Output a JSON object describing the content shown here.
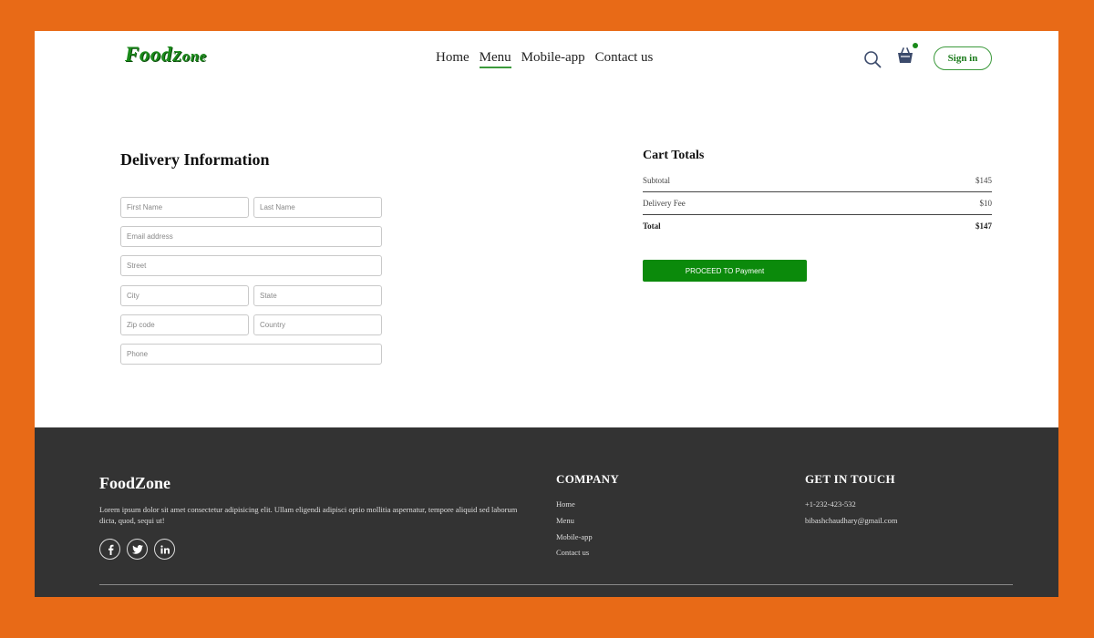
{
  "header": {
    "logo_part1": "Food",
    "logo_part2": "Zone",
    "nav": [
      "Home",
      "Menu",
      "Mobile-app",
      "Contact us"
    ],
    "active_nav": "Menu",
    "signin_label": "Sign in",
    "accent_color": "#1a8a1a"
  },
  "delivery": {
    "title": "Delivery Information",
    "placeholders": {
      "first_name": "First Name",
      "last_name": "Last Name",
      "email": "Email address",
      "street": "Street",
      "city": "City",
      "state": "State",
      "zip": "Zip code",
      "country": "Country",
      "phone": "Phone"
    }
  },
  "cart": {
    "title": "Cart Totals",
    "subtotal_label": "Subtotal",
    "subtotal_value": "$145",
    "delivery_label": "Delivery Fee",
    "delivery_value": "$10",
    "total_label": "Total",
    "total_value": "$147",
    "proceed_label": "PROCEED TO Payment",
    "button_color": "#0b8a0b"
  },
  "footer": {
    "brand": "FoodZone",
    "description": "Lorem ipsum dolor sit amet consectetur adipisicing elit. Ullam eligendi adipisci optio mollitia aspernatur, tempore aliquid sed laborum dicta, quod, sequi ut!",
    "social_icons": [
      "facebook-icon",
      "twitter-icon",
      "linkedin-icon"
    ],
    "company_heading": "COMPANY",
    "company_links": [
      "Home",
      "Menu",
      "Mobile-app",
      "Contact us"
    ],
    "contact_heading": "GET IN TOUCH",
    "phone": "+1-232-423-532",
    "email": "bibashchaudhary@gmail.com"
  }
}
